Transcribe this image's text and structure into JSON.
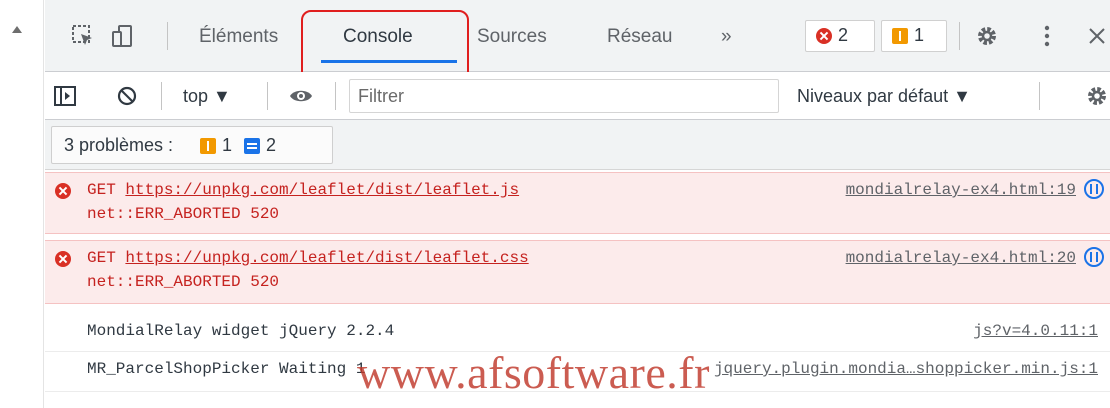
{
  "tabs": [
    {
      "label": "Éléments"
    },
    {
      "label": "Console"
    },
    {
      "label": "Sources"
    },
    {
      "label": "Réseau"
    }
  ],
  "more_tabs": "»",
  "error_count": "2",
  "warning_count": "1",
  "toolbar": {
    "context": "top ▼",
    "filter_placeholder": "Filtrer",
    "levels": "Niveaux par défaut ▼"
  },
  "issues": {
    "label": "3 problèmes :",
    "warnings": "1",
    "info": "2"
  },
  "messages": [
    {
      "type": "error",
      "method": "GET ",
      "url": "https://unpkg.com/leaflet/dist/leaflet.js",
      "detail": "net::ERR_ABORTED 520",
      "source": "mondialrelay-ex4.html:19"
    },
    {
      "type": "error",
      "method": "GET ",
      "url": "https://unpkg.com/leaflet/dist/leaflet.css",
      "detail": "net::ERR_ABORTED 520",
      "source": "mondialrelay-ex4.html:20"
    },
    {
      "type": "log",
      "text": "MondialRelay widget jQuery 2.2.4",
      "source": "js?v=4.0.11:1"
    },
    {
      "type": "log",
      "text": "MR_ParcelShopPicker Waiting 1",
      "source": "jquery.plugin.mondia…shoppicker.min.js:1"
    }
  ],
  "watermark": "www.afsoftware.fr",
  "colors": {
    "accent": "#1a73e8",
    "error": "#d93025",
    "warning": "#f29900",
    "highlight": "#e01e1e"
  }
}
